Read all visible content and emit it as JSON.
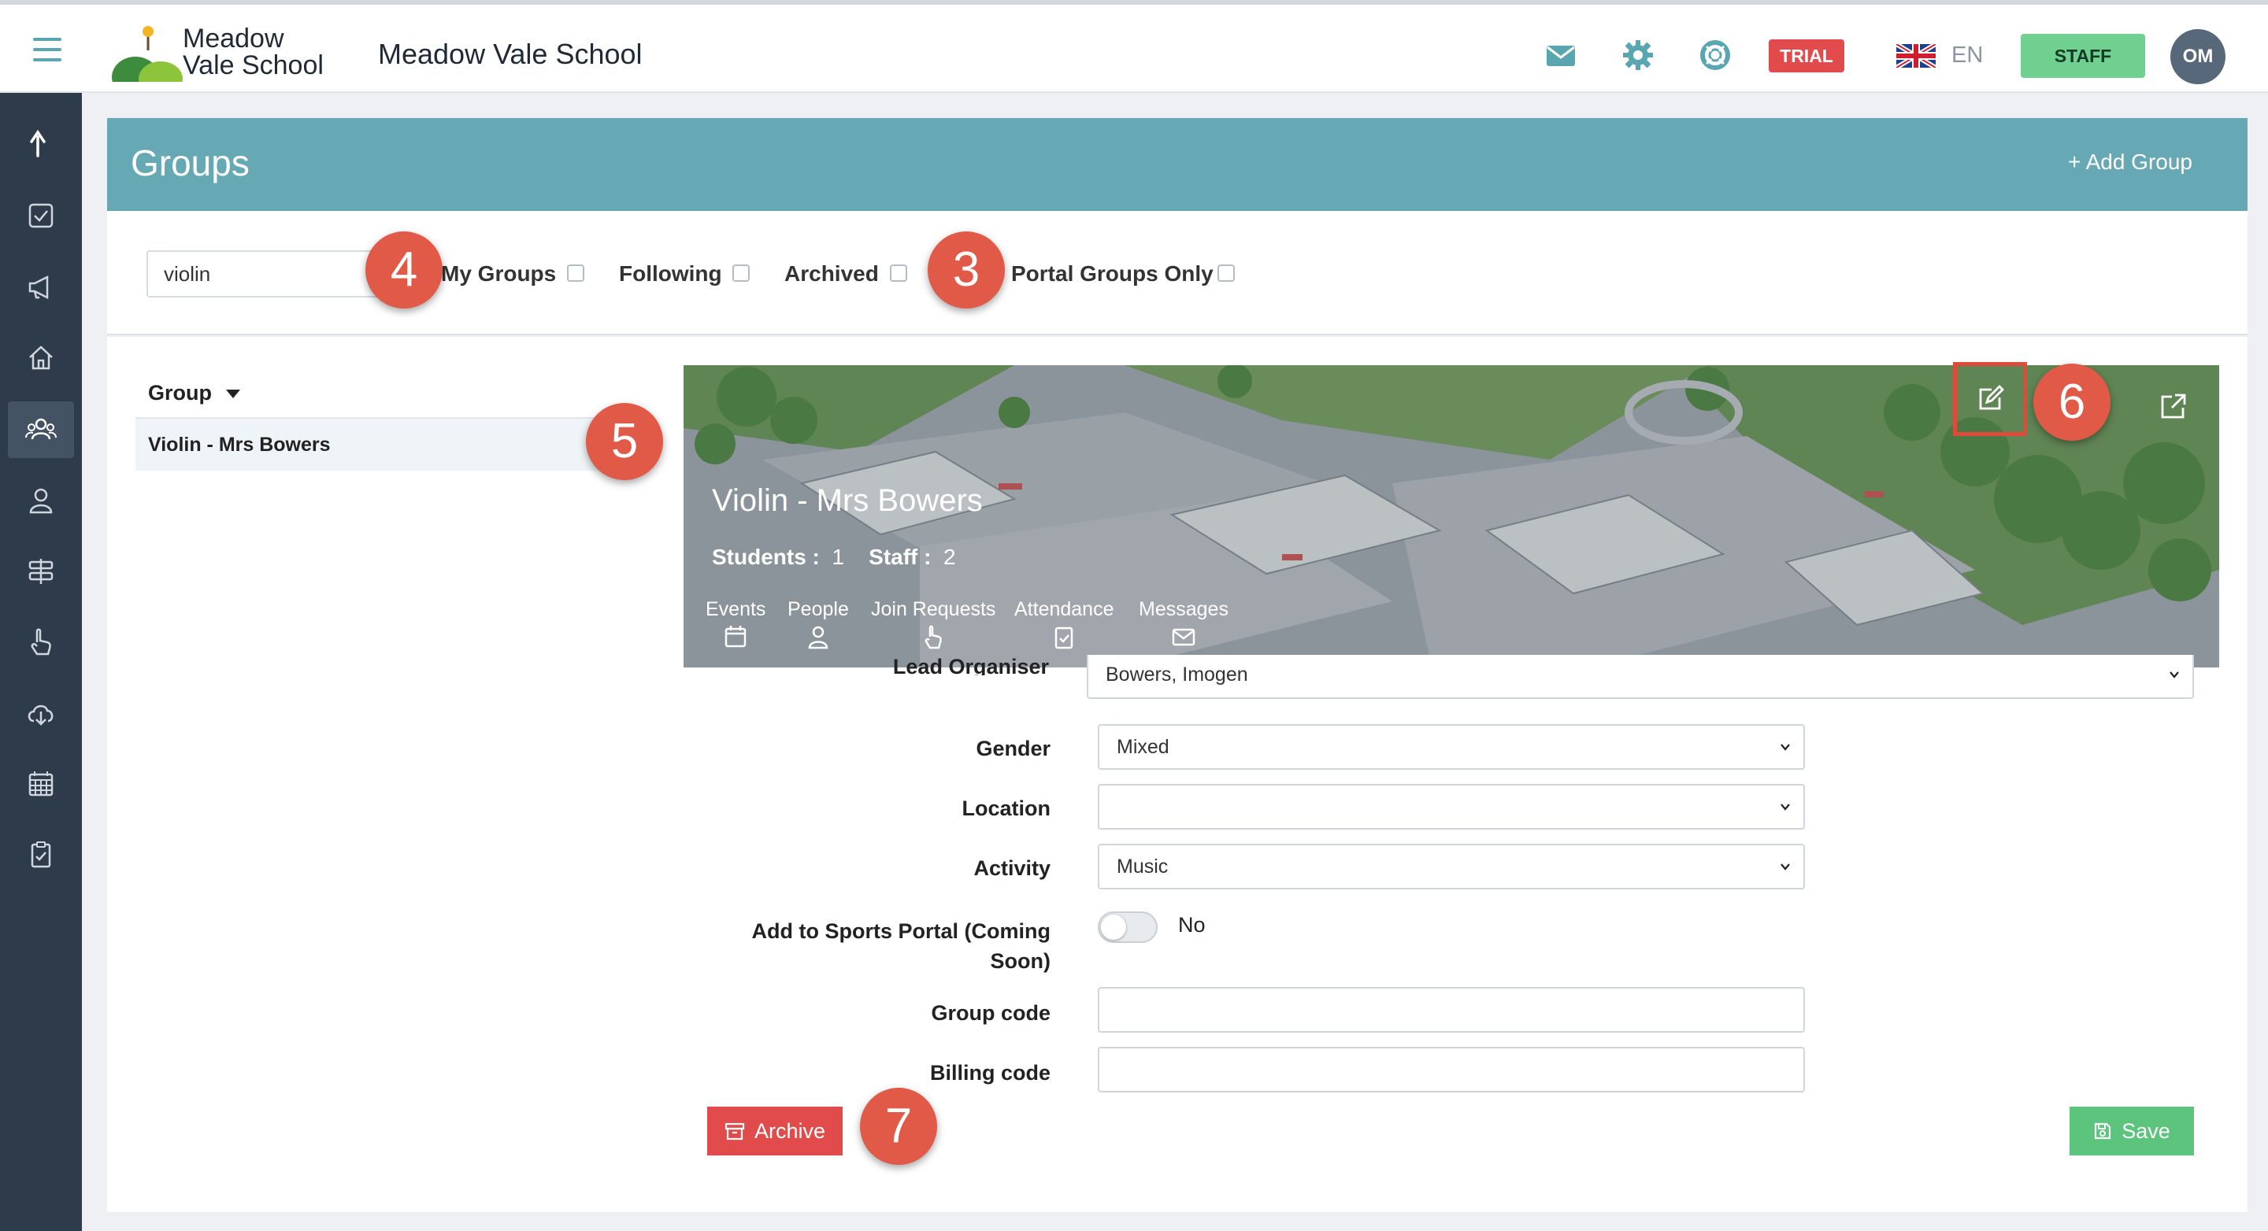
{
  "app": {
    "logo_line1": "Meadow",
    "logo_line2": "Vale School",
    "school_name": "Meadow Vale School",
    "trial_badge": "TRIAL",
    "language": "EN",
    "role_badge": "STAFF",
    "avatar_initials": "OM"
  },
  "page": {
    "title": "Groups",
    "add_group_label": "+ Add Group"
  },
  "filters": {
    "search_value": "violin",
    "my_groups": "My Groups",
    "following": "Following",
    "archived": "Archived",
    "portal_groups_only": "Portal Groups Only"
  },
  "group_list": {
    "column_header": "Group",
    "rows": [
      "Violin - Mrs Bowers"
    ]
  },
  "group_detail": {
    "name": "Violin - Mrs Bowers",
    "students_label": "Students :",
    "students_count": "1",
    "staff_label": "Staff :",
    "staff_count": "2",
    "tabs": [
      "Events",
      "People",
      "Join Requests",
      "Attendance",
      "Messages"
    ]
  },
  "form": {
    "lead_organiser_label": "Lead Organiser",
    "lead_organiser_value": "Bowers, Imogen",
    "gender_label": "Gender",
    "gender_value": "Mixed",
    "location_label": "Location",
    "location_value": "",
    "activity_label": "Activity",
    "activity_value": "Music",
    "sports_portal_label_line1": "Add to Sports Portal (Coming",
    "sports_portal_label_line2": "Soon)",
    "sports_portal_value": "No",
    "group_code_label": "Group code",
    "billing_code_label": "Billing code",
    "archive_button": "Archive",
    "save_button": "Save"
  },
  "annotations": {
    "marker_3": "3",
    "marker_4": "4",
    "marker_5": "5",
    "marker_6": "6",
    "marker_7": "7"
  },
  "colors": {
    "header_band": "#66a8b3",
    "sidebar": "#2e3b4a",
    "trial": "#e14b4b",
    "staff_badge": "#6fd090",
    "archive": "#e14b4b",
    "save": "#5cc47c",
    "marker": "#e05a47"
  }
}
